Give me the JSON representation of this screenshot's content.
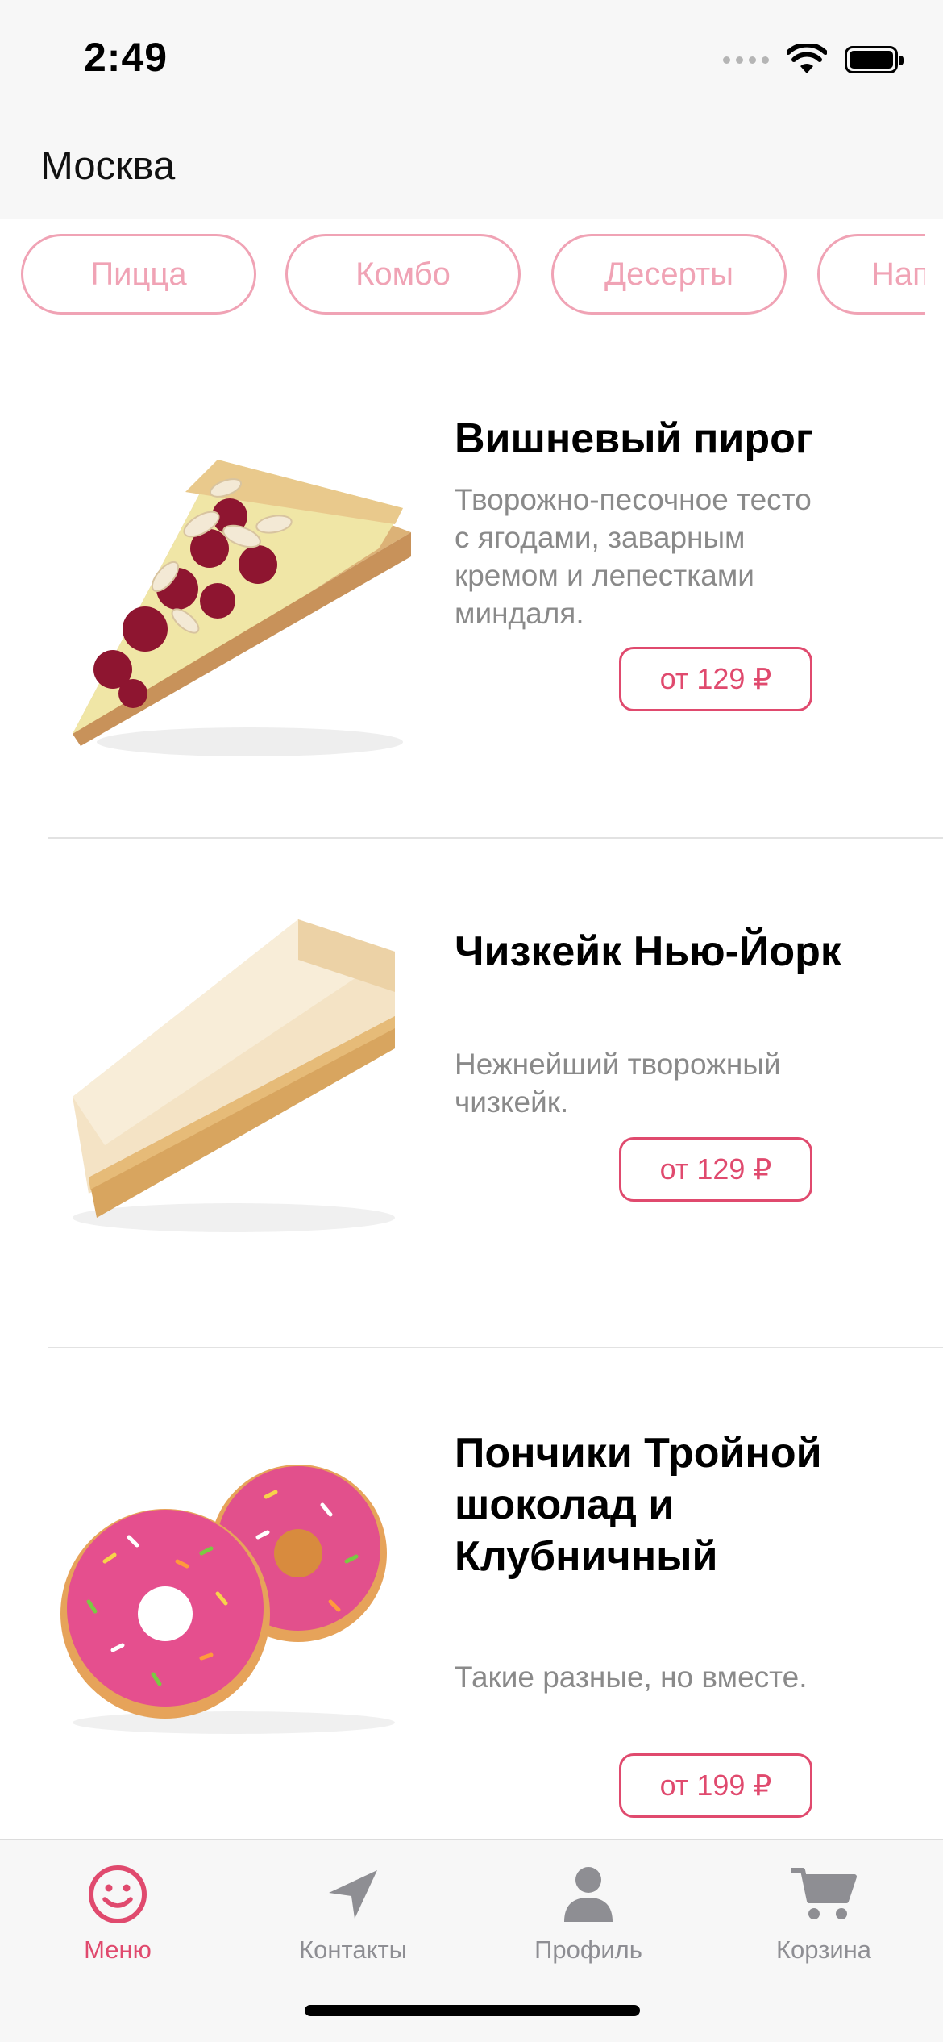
{
  "status_bar": {
    "time": "2:49"
  },
  "header": {
    "city": "Москва"
  },
  "categories": [
    {
      "label": "Пицца"
    },
    {
      "label": "Комбо"
    },
    {
      "label": "Десерты"
    },
    {
      "label": "Напитки"
    }
  ],
  "products": [
    {
      "title": "Вишневый пирог",
      "description": "Творожно-песочное тесто с ягодами, заварным кремом и лепестками миндаля.",
      "price": "от 129 ₽",
      "image_icon": "cherry-pie-icon"
    },
    {
      "title": "Чизкейк Нью-Йорк",
      "description": "Нежнейший творожный чизкейк.",
      "price": "от 129 ₽",
      "image_icon": "cheesecake-icon"
    },
    {
      "title": "Пончики Тройной шоколад и Клубничный",
      "description": "Такие разные, но вместе.",
      "price": "от 199 ₽",
      "image_icon": "donuts-icon"
    }
  ],
  "tabbar": {
    "items": [
      {
        "label": "Меню",
        "icon": "smile-icon",
        "active": true
      },
      {
        "label": "Контакты",
        "icon": "location-arrow-icon",
        "active": false
      },
      {
        "label": "Профиль",
        "icon": "person-icon",
        "active": false
      },
      {
        "label": "Корзина",
        "icon": "cart-icon",
        "active": false
      }
    ]
  },
  "colors": {
    "accent": "#e04a6e",
    "chip": "#f0a3b5",
    "secondary_text": "#8a8a8a",
    "inactive_tab": "#8e8e93"
  }
}
